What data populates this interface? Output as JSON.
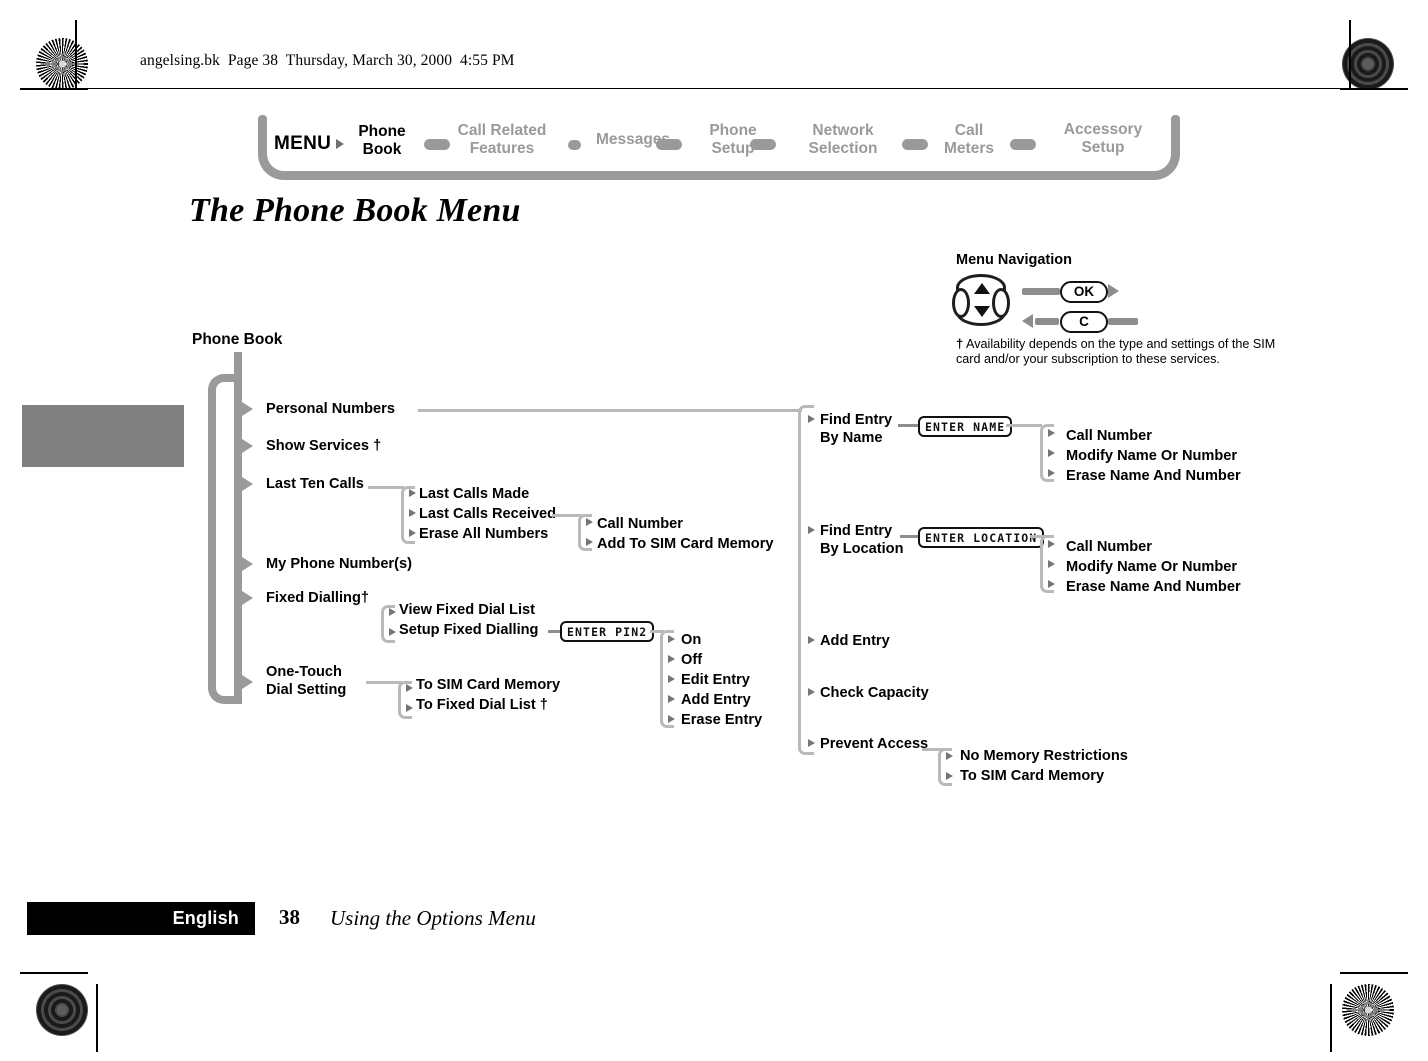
{
  "header": {
    "file_line": "angelsing.bk  Page 38  Thursday, March 30, 2000  4:55 PM"
  },
  "menubar": {
    "menu_word": "MENU",
    "items": [
      {
        "label": "Phone\nBook",
        "active": true
      },
      {
        "label": "Call Related\nFeatures",
        "active": false
      },
      {
        "label": "Messages",
        "active": false
      },
      {
        "label": "Phone\nSetup",
        "active": false
      },
      {
        "label": "Network\nSelection",
        "active": false
      },
      {
        "label": "Call\nMeters",
        "active": false
      },
      {
        "label": "Accessory\nSetup",
        "active": false
      }
    ]
  },
  "page_title": "The Phone Book Menu",
  "legend": {
    "title": "Menu Navigation",
    "ok_key": "OK",
    "c_key": "C",
    "footnote_mark": "†",
    "footnote_text": "Availability depends on the type and settings of the SIM card and/or your subscription to these services."
  },
  "tree": {
    "root": "Phone Book",
    "level1": [
      {
        "label": "Personal Numbers"
      },
      {
        "label": "Show Services †"
      },
      {
        "label": "Last Ten Calls"
      },
      {
        "label": "My Phone Number(s)"
      },
      {
        "label": "Fixed Dialling†"
      },
      {
        "label": "One-Touch\nDial Setting"
      }
    ],
    "last_ten_calls_children": [
      "Last Calls Made",
      "Last Calls Received",
      "Erase All Numbers"
    ],
    "last_calls_received_children": [
      "Call Number",
      "Add To SIM Card Memory"
    ],
    "fixed_dialling_children": [
      "View Fixed Dial List",
      "Setup Fixed Dialling"
    ],
    "pin2_prompt": "ENTER PIN2",
    "pin2_children": [
      "On",
      "Off",
      "Edit Entry",
      "Add Entry",
      "Erase Entry"
    ],
    "one_touch_children": [
      "To SIM Card Memory",
      "To Fixed Dial List †"
    ],
    "personal_numbers_items": [
      {
        "label": "Find Entry\nBy Name"
      },
      {
        "label": "Find Entry\nBy Location"
      },
      {
        "label": "Add Entry"
      },
      {
        "label": "Check Capacity"
      },
      {
        "label": "Prevent Access"
      }
    ],
    "enter_name_prompt": "ENTER NAME",
    "enter_name_children": [
      "Call Number",
      "Modify Name Or Number",
      "Erase Name And Number"
    ],
    "enter_location_prompt": "ENTER LOCATION",
    "enter_location_children": [
      "Call Number",
      "Modify Name Or Number",
      "Erase Name And Number"
    ],
    "prevent_access_children": [
      "No Memory Restrictions",
      "To SIM Card Memory"
    ]
  },
  "footer": {
    "language": "English",
    "page_number": "38",
    "chapter": "Using the Options Menu"
  },
  "colors": {
    "gray_rule": "#9a9a9a",
    "light_rule": "#b9b9b9",
    "tab_block": "#808080",
    "black": "#000000"
  }
}
